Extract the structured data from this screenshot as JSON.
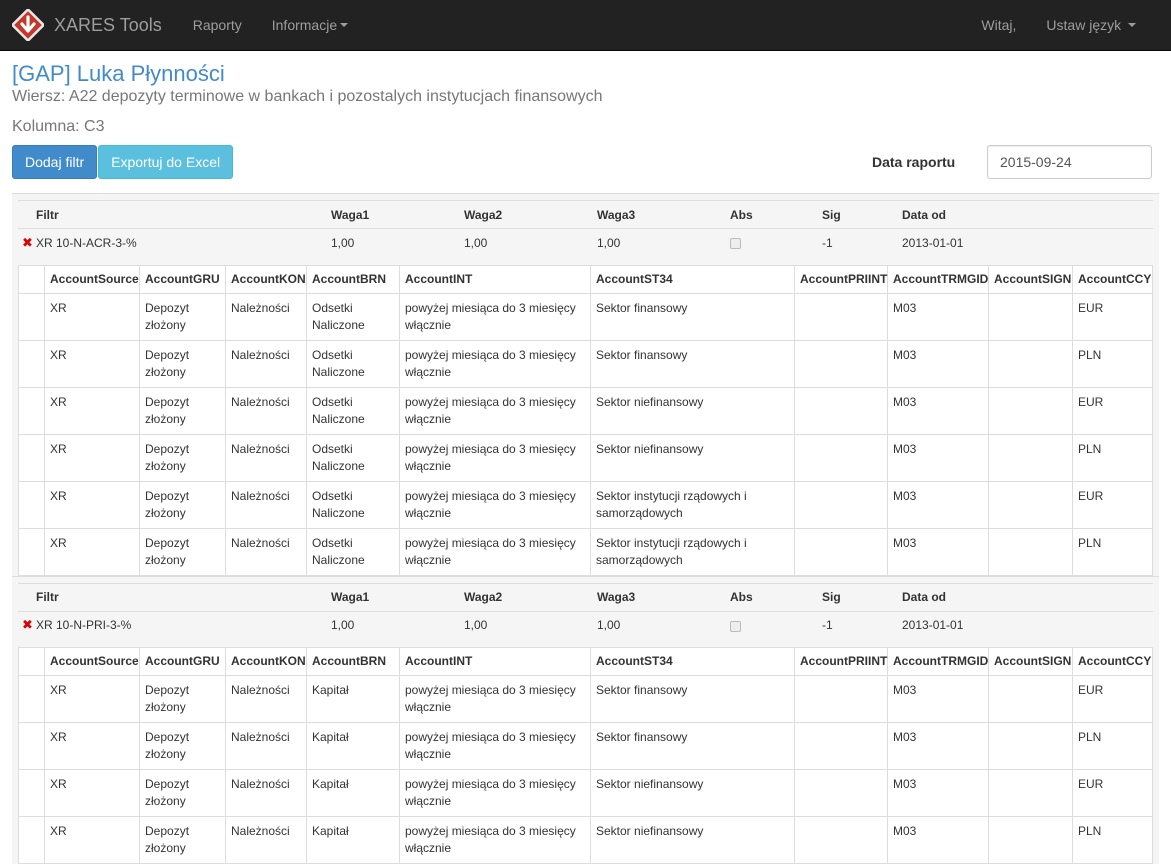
{
  "nav": {
    "brand": "XARES Tools",
    "items": [
      "Raporty",
      "Informacje"
    ],
    "greeting": "Witaj,",
    "language": "Ustaw język"
  },
  "page": {
    "title": "[GAP] Luka Płynności",
    "row_label": "Wiersz: A22 depozyty terminowe w bankach i pozostalych instytucjach finansowych",
    "col_label": "Kolumna: C3"
  },
  "toolbar": {
    "add_filter": "Dodaj filtr",
    "export": "Exportuj do Excel",
    "date_label": "Data raportu",
    "date_value": "2015-09-24"
  },
  "filter_headers": [
    "Filtr",
    "Waga1",
    "Waga2",
    "Waga3",
    "Abs",
    "Sig",
    "Data od"
  ],
  "account_headers": [
    "AccountSource",
    "AccountGRU",
    "AccountKON",
    "AccountBRN",
    "AccountINT",
    "AccountST34",
    "AccountPRIINT",
    "AccountTRMGID",
    "AccountSIGN",
    "AccountCCY"
  ],
  "colors": {
    "accent": "#428bca",
    "info": "#5bc0de",
    "danger": "#dd0000",
    "navbar": "#222222"
  },
  "filters": [
    {
      "remove_icon": "✖",
      "name": "XR 10-N-ACR-3-%",
      "waga1": "1,00",
      "waga2": "1,00",
      "waga3": "1,00",
      "sig": "-1",
      "date": "2013-01-01",
      "rows": [
        [
          "",
          "XR",
          "Depozyt złożony",
          "Należności",
          "Odsetki Naliczone",
          "powyżej miesiąca do 3 miesięcy włącznie",
          "Sektor finansowy",
          "",
          "M03",
          "",
          "EUR"
        ],
        [
          "",
          "XR",
          "Depozyt złożony",
          "Należności",
          "Odsetki Naliczone",
          "powyżej miesiąca do 3 miesięcy włącznie",
          "Sektor finansowy",
          "",
          "M03",
          "",
          "PLN"
        ],
        [
          "",
          "XR",
          "Depozyt złożony",
          "Należności",
          "Odsetki Naliczone",
          "powyżej miesiąca do 3 miesięcy włącznie",
          "Sektor niefinansowy",
          "",
          "M03",
          "",
          "EUR"
        ],
        [
          "",
          "XR",
          "Depozyt złożony",
          "Należności",
          "Odsetki Naliczone",
          "powyżej miesiąca do 3 miesięcy włącznie",
          "Sektor niefinansowy",
          "",
          "M03",
          "",
          "PLN"
        ],
        [
          "",
          "XR",
          "Depozyt złożony",
          "Należności",
          "Odsetki Naliczone",
          "powyżej miesiąca do 3 miesięcy włącznie",
          "Sektor instytucji rządowych i samorządowych",
          "",
          "M03",
          "",
          "EUR"
        ],
        [
          "",
          "XR",
          "Depozyt złożony",
          "Należności",
          "Odsetki Naliczone",
          "powyżej miesiąca do 3 miesięcy włącznie",
          "Sektor instytucji rządowych i samorządowych",
          "",
          "M03",
          "",
          "PLN"
        ]
      ]
    },
    {
      "remove_icon": "✖",
      "name": "XR 10-N-PRI-3-%",
      "waga1": "1,00",
      "waga2": "1,00",
      "waga3": "1,00",
      "sig": "-1",
      "date": "2013-01-01",
      "rows": [
        [
          "",
          "XR",
          "Depozyt złożony",
          "Należności",
          "Kapitał",
          "powyżej miesiąca do 3 miesięcy włącznie",
          "Sektor finansowy",
          "",
          "M03",
          "",
          "EUR"
        ],
        [
          "",
          "XR",
          "Depozyt złożony",
          "Należności",
          "Kapitał",
          "powyżej miesiąca do 3 miesięcy włącznie",
          "Sektor finansowy",
          "",
          "M03",
          "",
          "PLN"
        ],
        [
          "",
          "XR",
          "Depozyt złożony",
          "Należności",
          "Kapitał",
          "powyżej miesiąca do 3 miesięcy włącznie",
          "Sektor niefinansowy",
          "",
          "M03",
          "",
          "EUR"
        ],
        [
          "",
          "XR",
          "Depozyt złożony",
          "Należności",
          "Kapitał",
          "powyżej miesiąca do 3 miesięcy włącznie",
          "Sektor niefinansowy",
          "",
          "M03",
          "",
          "PLN"
        ]
      ]
    }
  ]
}
